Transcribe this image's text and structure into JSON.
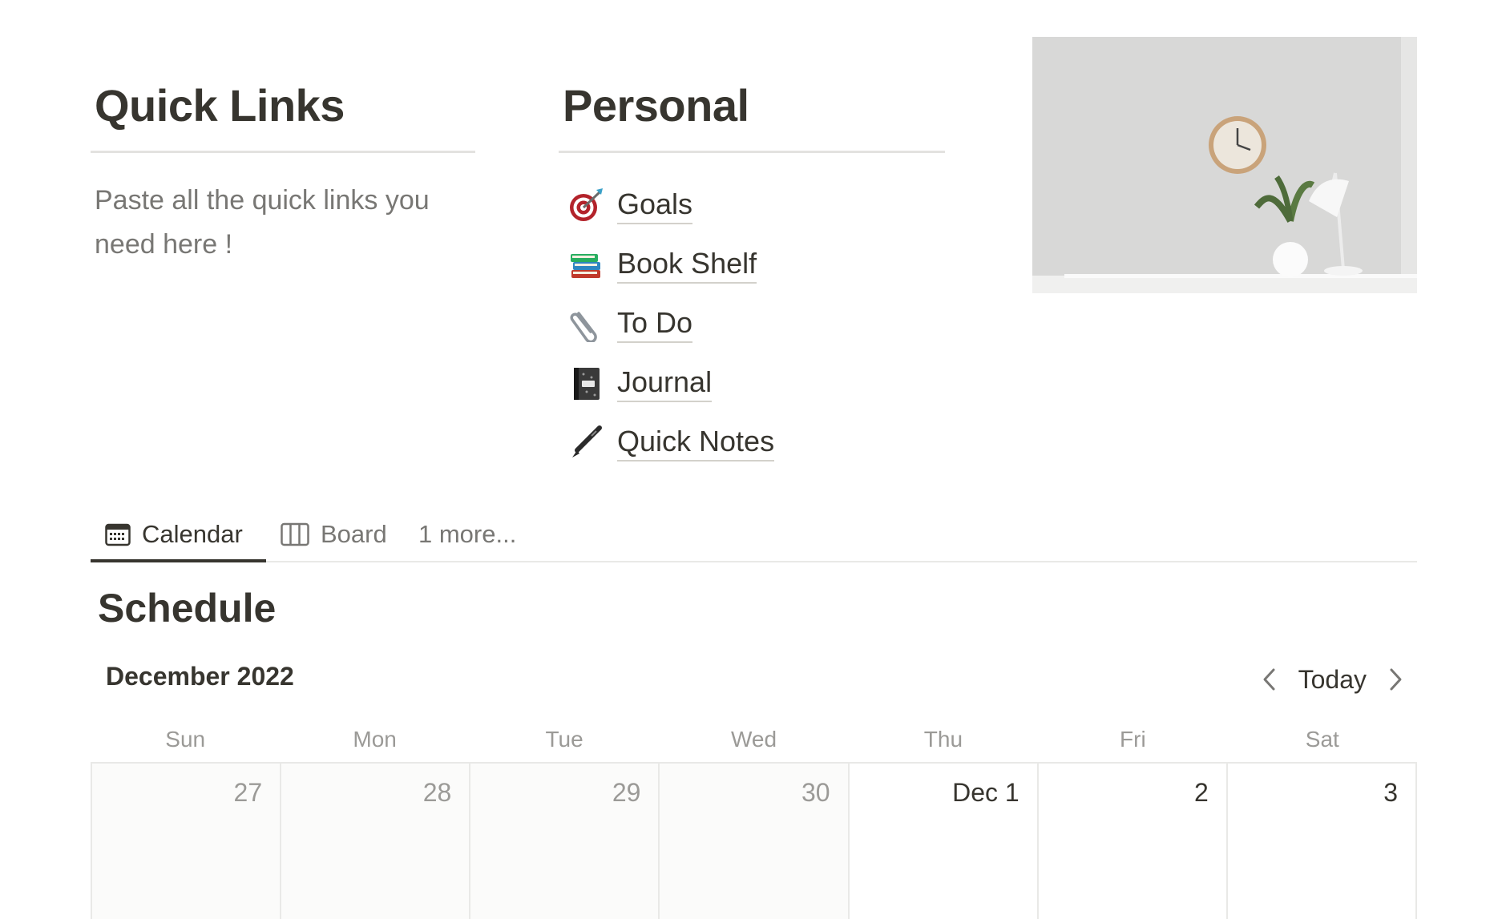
{
  "quick_links": {
    "heading": "Quick Links",
    "text": "Paste all the quick links you need here !"
  },
  "personal": {
    "heading": "Personal",
    "links": [
      {
        "label": "Goals",
        "icon": "target-icon"
      },
      {
        "label": "Book Shelf",
        "icon": "books-icon"
      },
      {
        "label": "To Do",
        "icon": "paperclip-icon"
      },
      {
        "label": "Journal",
        "icon": "notebook-icon"
      },
      {
        "label": "Quick Notes",
        "icon": "pen-icon"
      }
    ]
  },
  "tabs": {
    "calendar": "Calendar",
    "board": "Board",
    "more": "1 more..."
  },
  "schedule": {
    "title": "Schedule",
    "month": "December 2022",
    "today": "Today",
    "weekdays": [
      "Sun",
      "Mon",
      "Tue",
      "Wed",
      "Thu",
      "Fri",
      "Sat"
    ],
    "days": [
      "27",
      "28",
      "29",
      "30",
      "Dec 1",
      "2",
      "3"
    ]
  }
}
